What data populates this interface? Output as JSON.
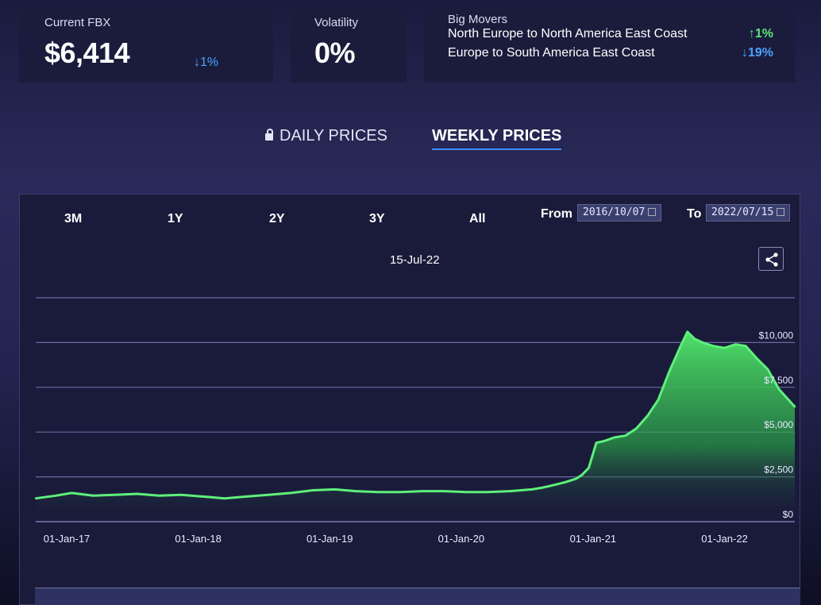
{
  "summary": {
    "current_label": "Current FBX",
    "current_value": "$6,414",
    "current_change": "↓1%",
    "volatility_label": "Volatility",
    "volatility_value": "0%",
    "movers_label": "Big Movers",
    "movers": [
      {
        "route": "North Europe to North America East Coast",
        "change": "↑1%",
        "direction": "up"
      },
      {
        "route": "Europe to South America East Coast",
        "change": "↓19%",
        "direction": "down"
      }
    ]
  },
  "tabs": {
    "daily": "DAILY PRICES",
    "weekly": "WEEKLY PRICES",
    "active": "weekly"
  },
  "controls": {
    "ranges": [
      "3M",
      "1Y",
      "2Y",
      "3Y",
      "All"
    ],
    "from_label": "From",
    "from_value": "2016/10/07",
    "to_label": "To",
    "to_value": "2022/07/15"
  },
  "chart_data": {
    "type": "area",
    "title": "15-Jul-22",
    "x_tick_labels": [
      "01-Jan-17",
      "01-Jan-18",
      "01-Jan-19",
      "01-Jan-20",
      "01-Jan-21",
      "01-Jan-22"
    ],
    "y_tick_labels": [
      "$0",
      "$2,500",
      "$5,000",
      "$7,500",
      "$10,000"
    ],
    "ylim": [
      0,
      12500
    ],
    "x_range": [
      "2016-10-07",
      "2022-07-15"
    ],
    "grid": true,
    "series": [
      {
        "color": "#5ef07a",
        "x": [
          "2016-10-07",
          "2016-12-01",
          "2017-01-15",
          "2017-03-15",
          "2017-05-15",
          "2017-07-15",
          "2017-09-15",
          "2017-11-15",
          "2018-01-15",
          "2018-03-15",
          "2018-05-15",
          "2018-07-15",
          "2018-09-15",
          "2018-11-15",
          "2019-01-15",
          "2019-03-15",
          "2019-05-15",
          "2019-07-15",
          "2019-09-15",
          "2019-11-15",
          "2020-01-15",
          "2020-03-15",
          "2020-05-15",
          "2020-07-15",
          "2020-08-15",
          "2020-09-15",
          "2020-10-15",
          "2020-11-15",
          "2020-12-01",
          "2020-12-20",
          "2021-01-10",
          "2021-02-01",
          "2021-03-01",
          "2021-04-01",
          "2021-05-01",
          "2021-06-01",
          "2021-07-01",
          "2021-08-01",
          "2021-09-01",
          "2021-09-20",
          "2021-10-10",
          "2021-11-01",
          "2021-12-01",
          "2022-01-01",
          "2022-02-01",
          "2022-03-01",
          "2022-04-01",
          "2022-05-01",
          "2022-06-01",
          "2022-07-15"
        ],
        "values": [
          1300,
          1450,
          1600,
          1450,
          1500,
          1550,
          1450,
          1500,
          1400,
          1300,
          1400,
          1500,
          1600,
          1750,
          1800,
          1700,
          1650,
          1650,
          1700,
          1700,
          1650,
          1650,
          1700,
          1800,
          1900,
          2050,
          2200,
          2400,
          2600,
          3000,
          4400,
          4500,
          4700,
          4800,
          5200,
          5900,
          6800,
          8400,
          9800,
          10600,
          10200,
          10000,
          9800,
          9700,
          9900,
          9800,
          9100,
          8500,
          7400,
          6414
        ]
      }
    ]
  }
}
